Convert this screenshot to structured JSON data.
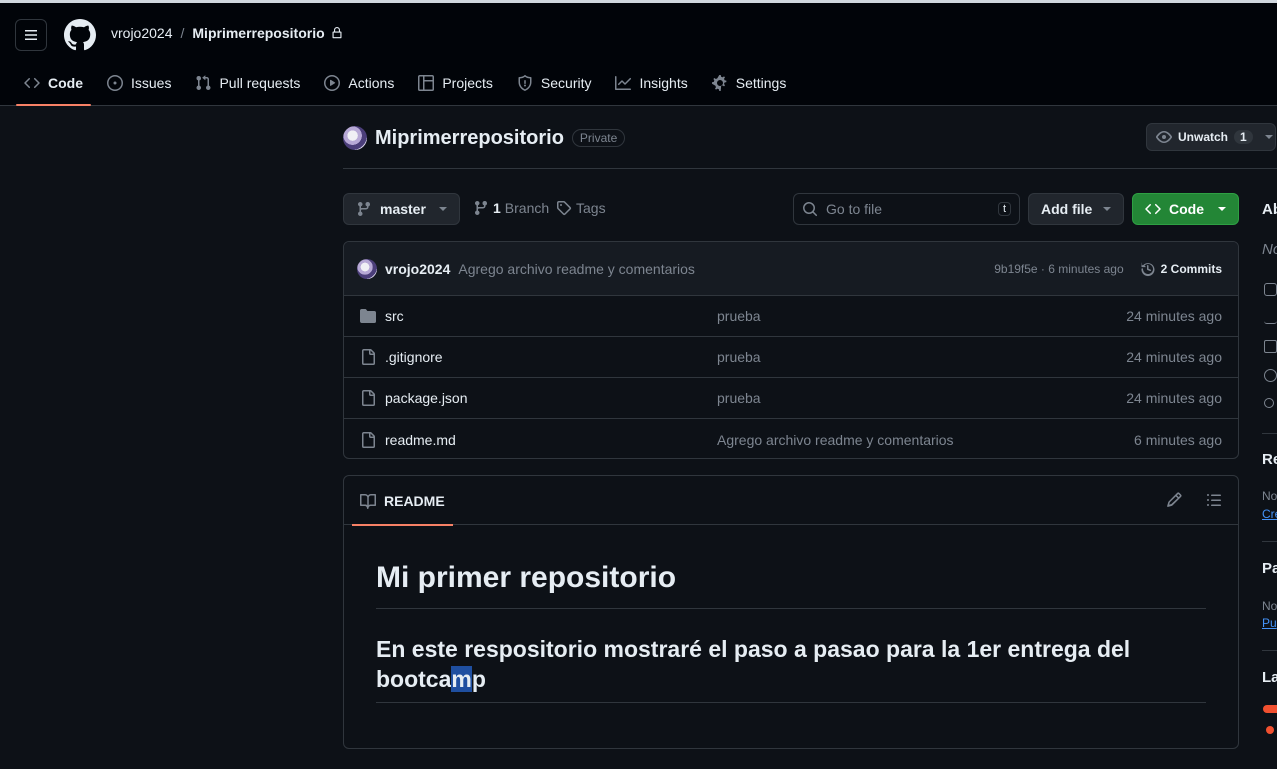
{
  "header": {
    "owner": "vrojo2024",
    "separator": "/",
    "repo": "Miprimerrepositorio"
  },
  "tabs": [
    {
      "label": "Code",
      "icon": "code-icon"
    },
    {
      "label": "Issues",
      "icon": "issue-icon"
    },
    {
      "label": "Pull requests",
      "icon": "pull-request-icon"
    },
    {
      "label": "Actions",
      "icon": "play-icon"
    },
    {
      "label": "Projects",
      "icon": "table-icon"
    },
    {
      "label": "Security",
      "icon": "shield-icon"
    },
    {
      "label": "Insights",
      "icon": "graph-icon"
    },
    {
      "label": "Settings",
      "icon": "gear-icon"
    }
  ],
  "repo_title": {
    "name": "Miprimerrepositorio",
    "visibility": "Private",
    "unwatch_label": "Unwatch",
    "watch_count": "1"
  },
  "toolbar": {
    "branch": "master",
    "branch_count": "1",
    "branch_label": "Branch",
    "tags_label": "Tags",
    "search_placeholder": "Go to file",
    "search_kbd": "t",
    "add_file": "Add file",
    "code": "Code"
  },
  "latest_commit": {
    "user": "vrojo2024",
    "message": "Agrego archivo readme y comentarios",
    "hash_time": "9b19f5e · 6 minutes ago",
    "commits": "2 Commits"
  },
  "files": [
    {
      "name": "src",
      "type": "folder",
      "message": "prueba",
      "time": "24 minutes ago"
    },
    {
      "name": ".gitignore",
      "type": "file",
      "message": "prueba",
      "time": "24 minutes ago"
    },
    {
      "name": "package.json",
      "type": "file",
      "message": "prueba",
      "time": "24 minutes ago"
    },
    {
      "name": "readme.md",
      "type": "file",
      "message": "Agrego archivo readme y comentarios",
      "time": "6 minutes ago"
    }
  ],
  "readme": {
    "tab": "README",
    "h1": "Mi primer repositorio",
    "h2_before": "En este respositorio mostraré el paso a pasao para la 1er entrega del bootca",
    "h2_selected": "m",
    "h2_after": "p"
  },
  "sidebar": {
    "about": "Ab",
    "no_desc": "No",
    "releases": "Re",
    "releases_note": "No",
    "releases_link": "Cre",
    "packages": "Pa",
    "packages_note": "No",
    "packages_link": "Pu",
    "languages": "La"
  },
  "colors": {
    "accent": "#f78166",
    "green": "#238636",
    "link": "#4493f8"
  }
}
